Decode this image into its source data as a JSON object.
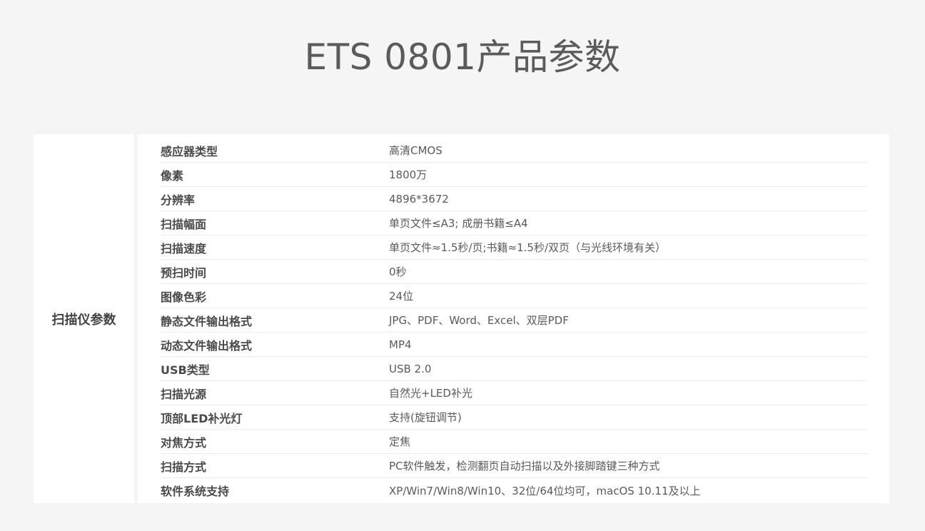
{
  "page": {
    "title": "ETS 0801产品参数"
  },
  "spec_table": {
    "category": "扫描仪参数",
    "rows": [
      {
        "label": "感应器类型",
        "value": "高清CMOS"
      },
      {
        "label": "像素",
        "value": "1800万"
      },
      {
        "label": "分辨率",
        "value": "4896*3672"
      },
      {
        "label": "扫描幅面",
        "value": "单页文件≤A3; 成册书籍≤A4"
      },
      {
        "label": "扫描速度",
        "value": "单页文件≈1.5秒/页;书籍≈1.5秒/双页（与光线环境有关）"
      },
      {
        "label": "预扫时间",
        "value": "0秒"
      },
      {
        "label": "图像色彩",
        "value": "24位"
      },
      {
        "label": "静态文件输出格式",
        "value": "JPG、PDF、Word、Excel、双层PDF"
      },
      {
        "label": "动态文件输出格式",
        "value": "MP4"
      },
      {
        "label": "USB类型",
        "value": "USB 2.0"
      },
      {
        "label": "扫描光源",
        "value": "自然光+LED补光"
      },
      {
        "label": "顶部LED补光灯",
        "value": "支持(旋钮调节)"
      },
      {
        "label": "对焦方式",
        "value": "定焦"
      },
      {
        "label": "扫描方式",
        "value": "PC软件触发，检测翻页自动扫描以及外接脚踏键三种方式"
      },
      {
        "label": "软件系统支持",
        "value": "XP/Win7/Win8/Win10、32位/64位均可，macOS 10.11及以上"
      }
    ]
  }
}
